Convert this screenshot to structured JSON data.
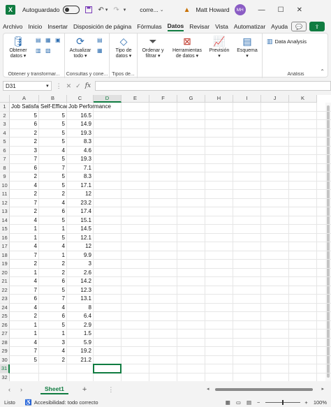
{
  "titlebar": {
    "autosave_label": "Autoguardado",
    "doc_name": "corre...",
    "user_name": "Matt Howard",
    "user_initials": "MH"
  },
  "tabs": [
    "Archivo",
    "Inicio",
    "Insertar",
    "Disposición de página",
    "Fórmulas",
    "Datos",
    "Revisar",
    "Vista",
    "Automatizar",
    "Ayuda"
  ],
  "active_tab": "Datos",
  "ribbon": {
    "get_data": "Obtener datos",
    "refresh_all": "Actualizar todo",
    "data_types": "Tipo de datos",
    "sort_filter": "Ordenar y filtrar",
    "data_tools": "Herramientas de datos",
    "forecast": "Previsión",
    "outline": "Esquema",
    "data_analysis": "Data Analysis",
    "group_get_transform": "Obtener y transformar...",
    "group_queries": "Consultas y cone...",
    "group_data_types": "Tipos de...",
    "group_analysis": "Análisis"
  },
  "formula_bar": {
    "name_box": "D31",
    "fx_label": "fx",
    "formula": ""
  },
  "columns": [
    "A",
    "B",
    "C",
    "D",
    "E",
    "F",
    "G",
    "H",
    "I",
    "J",
    "K"
  ],
  "rows": [
    "1",
    "2",
    "3",
    "4",
    "5",
    "6",
    "7",
    "8",
    "9",
    "10",
    "11",
    "12",
    "13",
    "14",
    "15",
    "16",
    "17",
    "18",
    "19",
    "20",
    "21",
    "22",
    "23",
    "24",
    "25",
    "26",
    "27",
    "28",
    "29",
    "30",
    "31",
    "32"
  ],
  "headers": [
    "Job Satisfaction",
    "Self-Efficacy",
    "Job Performance"
  ],
  "data": [
    [
      "5",
      "5",
      "16.5"
    ],
    [
      "6",
      "5",
      "14.9"
    ],
    [
      "2",
      "5",
      "19.3"
    ],
    [
      "2",
      "5",
      "8.3"
    ],
    [
      "3",
      "4",
      "4.6"
    ],
    [
      "7",
      "5",
      "19.3"
    ],
    [
      "6",
      "7",
      "7.1"
    ],
    [
      "2",
      "5",
      "8.3"
    ],
    [
      "4",
      "5",
      "17.1"
    ],
    [
      "2",
      "2",
      "12"
    ],
    [
      "7",
      "4",
      "23.2"
    ],
    [
      "2",
      "6",
      "17.4"
    ],
    [
      "4",
      "5",
      "15.1"
    ],
    [
      "1",
      "1",
      "14.5"
    ],
    [
      "1",
      "5",
      "12.1"
    ],
    [
      "4",
      "4",
      "12"
    ],
    [
      "7",
      "1",
      "9.9"
    ],
    [
      "2",
      "2",
      "3"
    ],
    [
      "1",
      "2",
      "2.6"
    ],
    [
      "4",
      "6",
      "14.2"
    ],
    [
      "7",
      "5",
      "12.3"
    ],
    [
      "6",
      "7",
      "13.1"
    ],
    [
      "4",
      "4",
      "8"
    ],
    [
      "2",
      "6",
      "6.4"
    ],
    [
      "1",
      "5",
      "2.9"
    ],
    [
      "1",
      "1",
      "1.5"
    ],
    [
      "4",
      "3",
      "5.9"
    ],
    [
      "7",
      "4",
      "19.2"
    ],
    [
      "5",
      "2",
      "21.2"
    ]
  ],
  "sheet_tab": "Sheet1",
  "status": {
    "ready": "Listo",
    "accessibility": "Accesibilidad: todo correcto",
    "zoom": "100%"
  }
}
